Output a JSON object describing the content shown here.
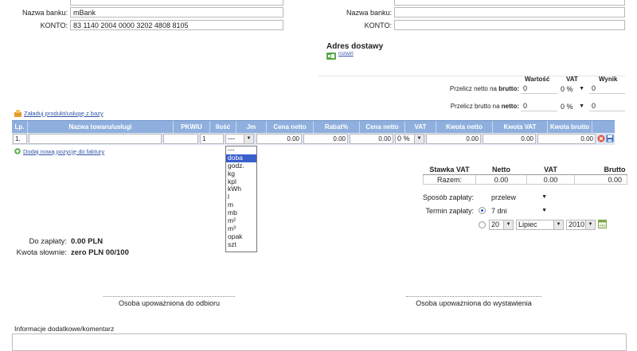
{
  "seller": {
    "bank_label": "Nazwa banku:",
    "bank_value": "mBank",
    "account_label": "KONTO:",
    "account_value": "83 1140 2004 0000 3202 4808 8105"
  },
  "buyer": {
    "bank_label": "Nazwa banku:",
    "bank_value": "",
    "account_label": "KONTO:",
    "account_value": ""
  },
  "delivery": {
    "title": "Adres dostawy",
    "expand_link": "rozwiń"
  },
  "calc": {
    "h_value": "Wartość",
    "h_vat": "VAT",
    "h_result": "Wynik",
    "net_to_gross_label": "Przelicz netto na",
    "net_to_gross_bold": "brutto:",
    "net_to_gross_value": "0",
    "net_to_gross_vat": "0 %",
    "net_to_gross_result": "0",
    "gross_to_net_label": "Przelicz brutto na",
    "gross_to_net_bold": "netto:",
    "gross_to_net_value": "0",
    "gross_to_net_vat": "0 %",
    "gross_to_net_result": "0"
  },
  "load_products_link": "Załaduj produkt/usługę z bazy",
  "table": {
    "headers": [
      "Lp.",
      "Nazwa towaru/usługi",
      "PKWiU",
      "Ilość",
      "Jm",
      "Cena netto",
      "Rabat%",
      "Cena netto",
      "VAT",
      "Kwota netto",
      "Kwota VAT",
      "Kwota brutto"
    ],
    "row": {
      "lp": "1.",
      "name": "",
      "pkwiu": "",
      "qty": "1",
      "unit": "---",
      "price_net": "0.00",
      "discount": "0.00",
      "price_net2": "0.00",
      "vat": "0 %",
      "amount_net": "0.00",
      "amount_vat": "0.00",
      "amount_gross": "0.00"
    }
  },
  "add_line_link": "Dodaj nową pozycję do faktury",
  "unit_options": [
    "---",
    "doba",
    "godz.",
    "kg",
    "kpl",
    "kWh",
    "l",
    "m",
    "mb",
    "m²",
    "m³",
    "opak",
    "szt"
  ],
  "unit_highlighted": "doba",
  "vat_summary": {
    "headers": [
      "Stawka VAT",
      "Netto",
      "VAT",
      "Brutto"
    ],
    "row": [
      "Razem:",
      "0.00",
      "0.00",
      "0.00"
    ]
  },
  "payment": {
    "method_label": "Sposób zapłaty:",
    "method_value": "przelew",
    "term_label": "Termin zapłaty:",
    "term_days": "7 dni",
    "date_day": "20",
    "date_month": "Lipiec",
    "date_year": "2010"
  },
  "totals": {
    "to_pay_label": "Do zapłaty:",
    "to_pay_value": "0.00 PLN",
    "words_label": "Kwota słownie:",
    "words_value": "zero PLN 00/100"
  },
  "signatures": {
    "receiver": "Osoba upoważniona do odbioru",
    "issuer": "Osoba upoważniona do wystawienia"
  },
  "notes_label": "Informacje dodatkowe/komentarz"
}
